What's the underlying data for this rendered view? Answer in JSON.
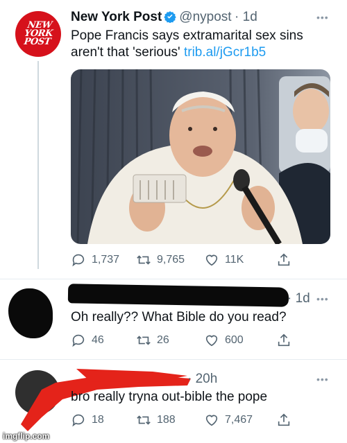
{
  "tweet1": {
    "name": "New York Post",
    "handle": "@nypost",
    "time": "· 1d",
    "more": "•••",
    "text": "Pope Francis says extramarital sex sins aren't that 'serious'",
    "link": "trib.al/jGcr1b5",
    "logo_lines": [
      "NEW",
      "YORK",
      "POST"
    ],
    "replies": "1,737",
    "retweets": "9,765",
    "likes": "11K"
  },
  "reply1": {
    "time": "· 1d",
    "more": "•••",
    "text": "Oh really?? What Bible do you read?",
    "replies": "46",
    "retweets": "26",
    "likes": "600"
  },
  "reply2": {
    "time": "· 20h",
    "more": "•••",
    "text": "bro really tryna out-bible the pope",
    "replies": "18",
    "retweets": "188",
    "likes": "7,467"
  },
  "watermark": "imgflip.com",
  "colors": {
    "brand_red": "#d6111b",
    "link_blue": "#1d9bf0",
    "muted": "#536471"
  }
}
